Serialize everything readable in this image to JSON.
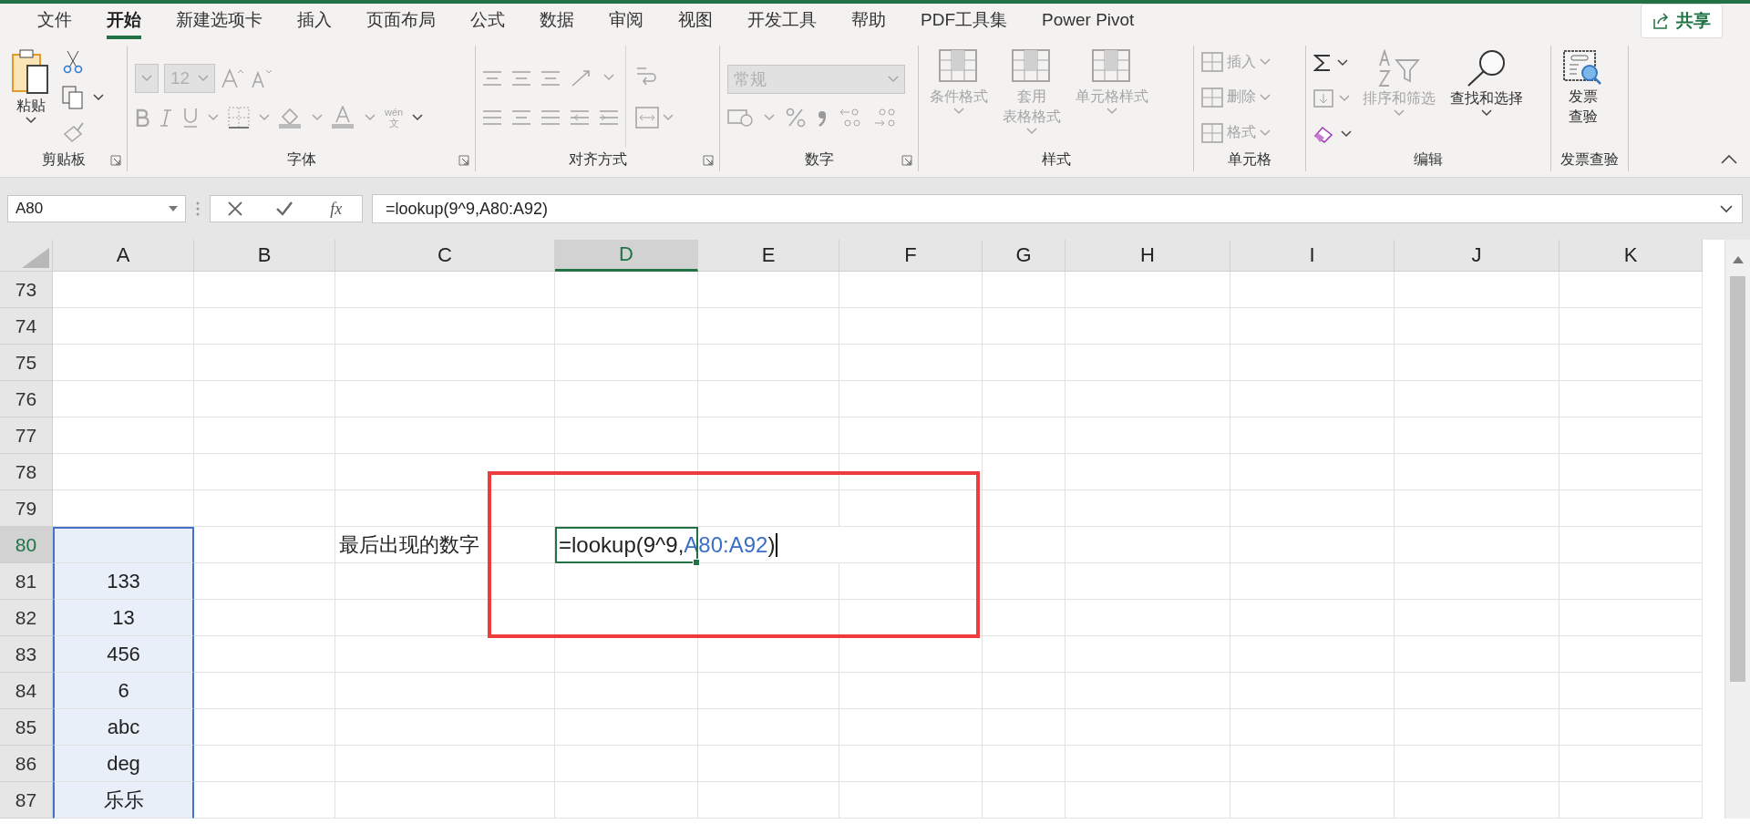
{
  "tabs": [
    {
      "label": "文件",
      "selected": false
    },
    {
      "label": "开始",
      "selected": true
    },
    {
      "label": "新建选项卡",
      "selected": false
    },
    {
      "label": "插入",
      "selected": false
    },
    {
      "label": "页面布局",
      "selected": false
    },
    {
      "label": "公式",
      "selected": false
    },
    {
      "label": "数据",
      "selected": false
    },
    {
      "label": "审阅",
      "selected": false
    },
    {
      "label": "视图",
      "selected": false
    },
    {
      "label": "开发工具",
      "selected": false
    },
    {
      "label": "帮助",
      "selected": false
    },
    {
      "label": "PDF工具集",
      "selected": false
    },
    {
      "label": "Power Pivot",
      "selected": false
    }
  ],
  "share_button": {
    "label": "共享"
  },
  "ribbon_groups": [
    {
      "kind": "clipboard",
      "label": "剪贴板",
      "dialog_launcher": true,
      "buttons": [
        {
          "label": "粘贴",
          "disabled": false
        }
      ]
    },
    {
      "kind": "font",
      "label": "字体",
      "dialog_launcher": true,
      "font_name": {
        "disabled": true
      },
      "font_size": {
        "value": "12",
        "disabled": true
      },
      "phonetic_guide": {
        "top": "wén",
        "bottom": "文"
      }
    },
    {
      "kind": "alignment",
      "label": "对齐方式",
      "dialog_launcher": true
    },
    {
      "kind": "number",
      "label": "数字",
      "dialog_launcher": true,
      "format": {
        "value": "常规",
        "disabled": true
      }
    },
    {
      "kind": "styles",
      "label": "样式",
      "buttons": [
        {
          "lines": [
            "条件格式"
          ],
          "disabled": true
        },
        {
          "lines": [
            "套用",
            "表格格式"
          ],
          "disabled": true
        },
        {
          "lines": [
            "单元格样式"
          ],
          "disabled": true
        }
      ]
    },
    {
      "kind": "cells",
      "label": "单元格",
      "buttons": [
        {
          "label": "插入",
          "disabled": true
        },
        {
          "label": "删除",
          "disabled": true
        },
        {
          "label": "格式",
          "disabled": true
        }
      ]
    },
    {
      "kind": "editing",
      "label": "编辑",
      "buttons": [
        {
          "label": "排序和筛选",
          "disabled": true
        },
        {
          "label": "查找和选择",
          "disabled": false
        }
      ]
    },
    {
      "kind": "invoice",
      "label": "发票查验",
      "buttons": [
        {
          "lines": [
            "发票",
            "查验"
          ],
          "disabled": false
        }
      ]
    }
  ],
  "formula_bar": {
    "name_box": "A80",
    "insert_function": "fx",
    "formula": "=lookup(9^9,A80:A92)"
  },
  "columns": [
    {
      "label": "A",
      "selected": false
    },
    {
      "label": "B",
      "selected": false
    },
    {
      "label": "C",
      "selected": false
    },
    {
      "label": "D",
      "selected": true
    },
    {
      "label": "E",
      "selected": false
    },
    {
      "label": "F",
      "selected": false
    },
    {
      "label": "G",
      "selected": false
    },
    {
      "label": "H",
      "selected": false
    },
    {
      "label": "I",
      "selected": false
    },
    {
      "label": "J",
      "selected": false
    },
    {
      "label": "K",
      "selected": false
    }
  ],
  "rows": [
    {
      "number": "73",
      "selected": false,
      "in_reference": false
    },
    {
      "number": "74",
      "selected": false,
      "in_reference": false
    },
    {
      "number": "75",
      "selected": false,
      "in_reference": false
    },
    {
      "number": "76",
      "selected": false,
      "in_reference": false
    },
    {
      "number": "77",
      "selected": false,
      "in_reference": false
    },
    {
      "number": "78",
      "selected": false,
      "in_reference": false
    },
    {
      "number": "79",
      "selected": false,
      "in_reference": false
    },
    {
      "number": "80",
      "selected": true,
      "in_reference": true,
      "column_c": "最后出现的数字",
      "editing": [
        {
          "kind": "plain",
          "text": "=lookup(9^9,"
        },
        {
          "kind": "reference",
          "text": "A80:A92"
        },
        {
          "kind": "plain",
          "text": ")"
        }
      ]
    },
    {
      "number": "81",
      "selected": false,
      "in_reference": true,
      "column_a": "133"
    },
    {
      "number": "82",
      "selected": false,
      "in_reference": true,
      "column_a": "13"
    },
    {
      "number": "83",
      "selected": false,
      "in_reference": true,
      "column_a": "456"
    },
    {
      "number": "84",
      "selected": false,
      "in_reference": true,
      "column_a": "6"
    },
    {
      "number": "85",
      "selected": false,
      "in_reference": true,
      "column_a": "abc"
    },
    {
      "number": "86",
      "selected": false,
      "in_reference": true,
      "column_a": "deg"
    },
    {
      "number": "87",
      "selected": false,
      "in_reference": true,
      "column_a": "乐乐"
    }
  ],
  "annotation_box": {
    "shown": true
  }
}
